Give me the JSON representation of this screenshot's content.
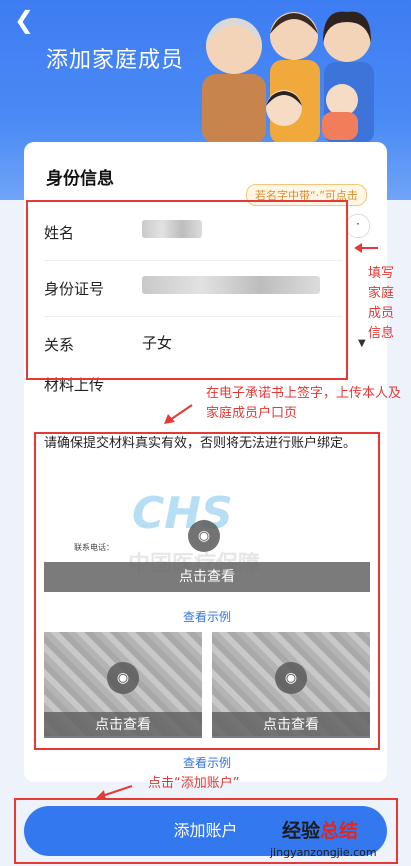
{
  "header": {
    "title": "添加家庭成员"
  },
  "identity": {
    "title": "身份信息",
    "hint": "若名字中带“·”可点击",
    "dot": "·",
    "name_label": "姓名",
    "id_label": "身份证号",
    "relation_label": "关系",
    "relation_value": "子女"
  },
  "materials": {
    "label": "材料上传",
    "notice": "请确保提交材料真实有效，否则将无法进行账户绑定。",
    "doc_watermark": "CHS",
    "doc_watermark_cn": "中国医疗保障",
    "doc_contact": "联系电话：",
    "view_button": "点击查看",
    "example_link": "查看示例"
  },
  "submit": {
    "label": "添加账户"
  },
  "annotations": {
    "fill_info": [
      "填写",
      "家庭",
      "成员",
      "信息"
    ],
    "upload_tip": "在电子承诺书上签字，上传本人及家庭成员户口页",
    "click_add": "点击“添加账户”"
  },
  "watermark": {
    "part1": "经验",
    "part2": "总结",
    "domain": "jingyanzongjie.com"
  },
  "colors": {
    "primary": "#3478f0",
    "annotation_red": "#e53935",
    "hint_orange": "#d98d2b"
  }
}
